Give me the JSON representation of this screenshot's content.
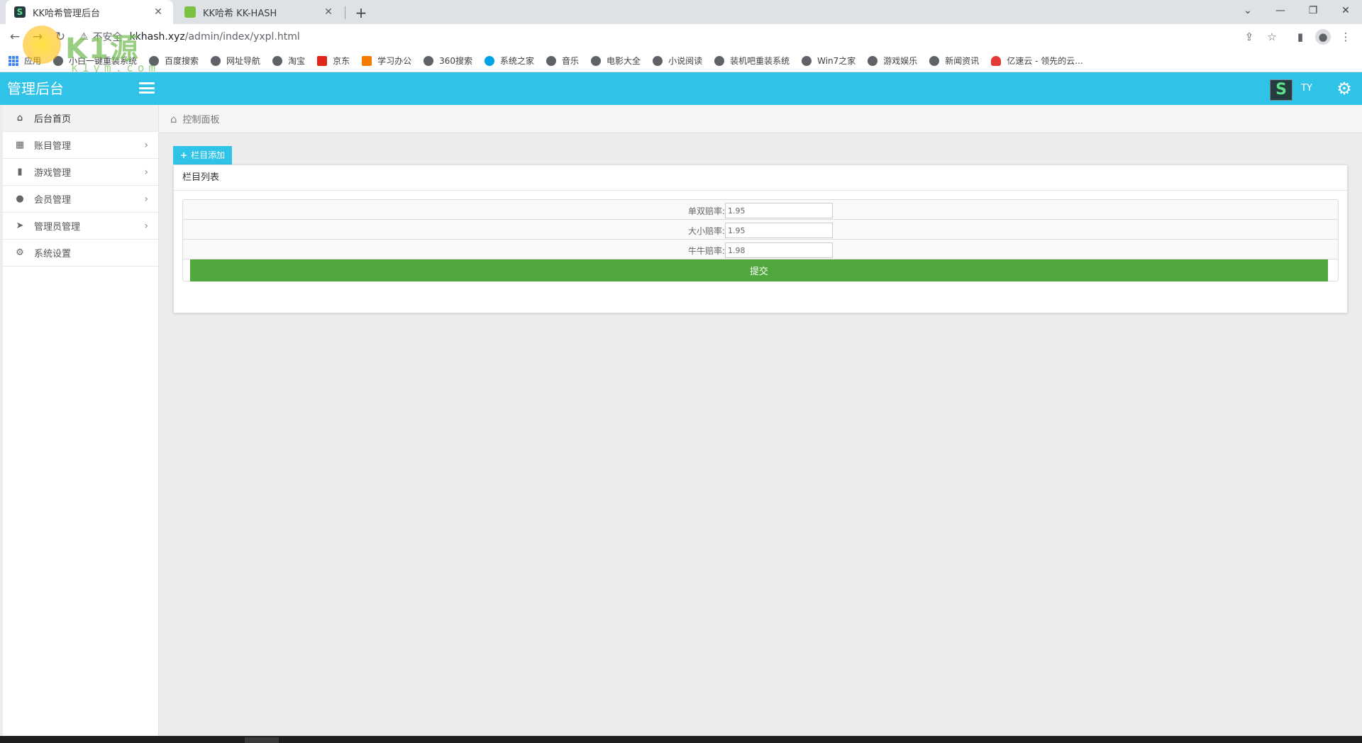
{
  "browser": {
    "tabs": [
      {
        "title": "KK哈希管理后台",
        "active": true,
        "favicon": "s-logo-icon"
      },
      {
        "title": "KK哈希 KK-HASH",
        "active": false,
        "favicon": "leaf-icon"
      }
    ],
    "address": {
      "security_label": "不安全",
      "url_host": "kkhash.xyz",
      "url_path": "/admin/index/yxpl.html"
    },
    "bookmarks": [
      "应用",
      "小白一键重装系统",
      "百度搜索",
      "网址导航",
      "淘宝",
      "京东",
      "学习办公",
      "360搜索",
      "系统之家",
      "音乐",
      "电影大全",
      "小说阅读",
      "装机吧重装系统",
      "Win7之家",
      "游戏娱乐",
      "新闻资讯",
      "亿速云 - 领先的云..."
    ]
  },
  "watermark": {
    "text": "K1源码",
    "sub": "k1ym.com"
  },
  "header": {
    "brand": "管理后台",
    "avatar_letter": "S",
    "user_name": "TY"
  },
  "sidebar": {
    "items": [
      {
        "label": "后台首页",
        "icon": "home-icon",
        "active": true
      },
      {
        "label": "账目管理",
        "icon": "grid-icon"
      },
      {
        "label": "游戏管理",
        "icon": "book-icon"
      },
      {
        "label": "会员管理",
        "icon": "user-icon"
      },
      {
        "label": "管理员管理",
        "icon": "paper-plane-icon"
      },
      {
        "label": "系统设置",
        "icon": "gear-icon"
      }
    ]
  },
  "breadcrumb": {
    "label": "控制面板"
  },
  "main": {
    "add_button": "栏目添加",
    "panel_title": "栏目列表",
    "fields": [
      {
        "label": "单双赔率:",
        "value": "1.95"
      },
      {
        "label": "大小赔率:",
        "value": "1.95"
      },
      {
        "label": "牛牛赔率:",
        "value": "1.98"
      }
    ],
    "submit_label": "提交"
  },
  "colors": {
    "header": "#2ec3e7",
    "submit": "#50a83d"
  }
}
